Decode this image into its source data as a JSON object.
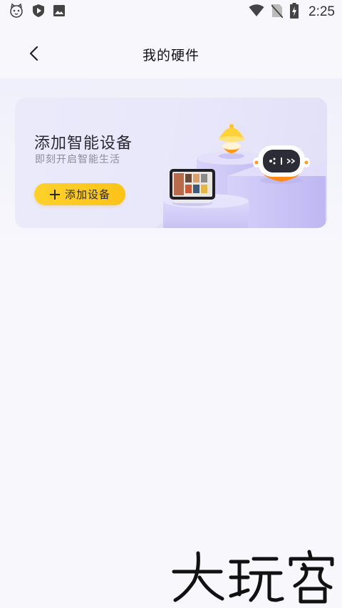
{
  "status_bar": {
    "time": "2:25",
    "left_icons": [
      "cat-notification-icon",
      "shield-play-icon",
      "image-icon"
    ],
    "right_icons": [
      "wifi-icon",
      "no-sim-icon",
      "battery-charging-icon"
    ]
  },
  "header": {
    "title": "我的硬件",
    "back_icon": "chevron-left-icon"
  },
  "card": {
    "title": "添加智能设备",
    "subtitle": "即刻开启智能生活",
    "button_label": "添加设备",
    "button_icon": "plus-icon",
    "button_color": "#fcc820"
  },
  "watermark": {
    "text": "大玩家"
  },
  "colors": {
    "background": "#f7f7fc",
    "card_background": "#e9e8fa",
    "accent": "#fcc820"
  }
}
